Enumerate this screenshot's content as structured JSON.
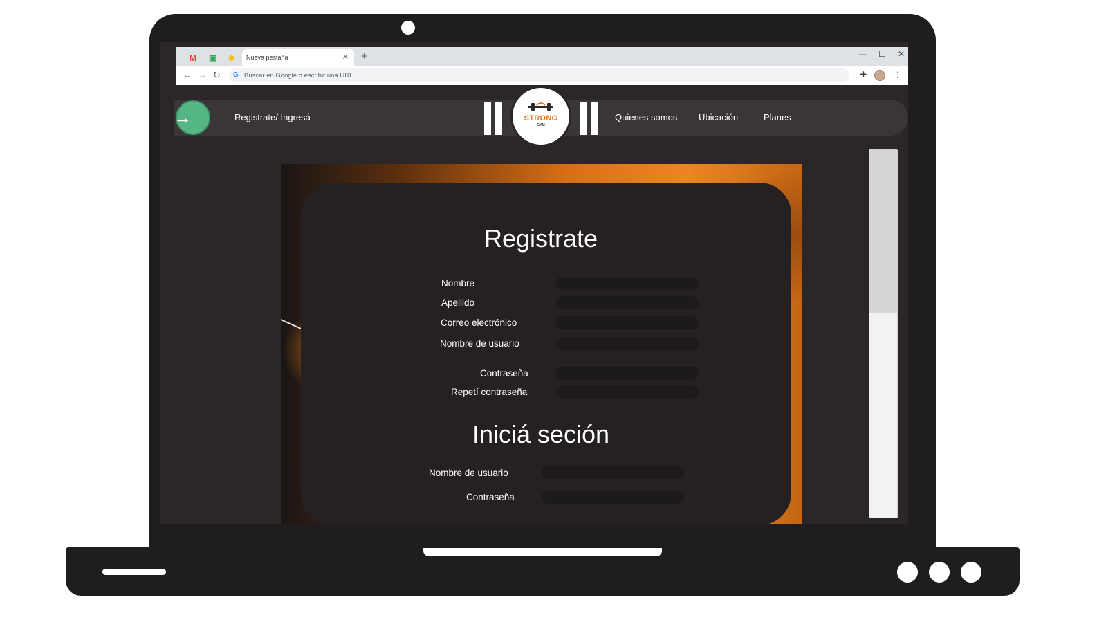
{
  "browser": {
    "tab_title": "Nueva pestaña",
    "tab_close": "✕",
    "new_tab": "+",
    "omnibox_placeholder": "Buscar en Google o escribir una URL",
    "pinned_icons": [
      "gmail-icon",
      "google-meet-icon",
      "google-photos-icon"
    ],
    "window_controls": [
      "minimize-icon",
      "maximize-icon",
      "close-icon"
    ]
  },
  "site_header": {
    "register_link": "Registrate/ Ingresá",
    "logo_text": "STRONG",
    "logo_subtext": "GYM",
    "nav": [
      "Quienes somos",
      "Ubicación",
      "Planes"
    ]
  },
  "register_form": {
    "title": "Registrate",
    "fields": [
      "Nombre",
      "Apellido",
      "Correo electrónico",
      "Nombre de usuario",
      "Contraseña",
      "Repetí contraseña"
    ]
  },
  "login_form": {
    "title": "Iniciá seción",
    "fields": [
      "Nombre de usuario",
      "Contraseña"
    ]
  },
  "colors": {
    "accent_green": "#55b585",
    "logo_orange": "#e4781e",
    "card_bg": "#252122",
    "frame": "#1f1d1e"
  }
}
